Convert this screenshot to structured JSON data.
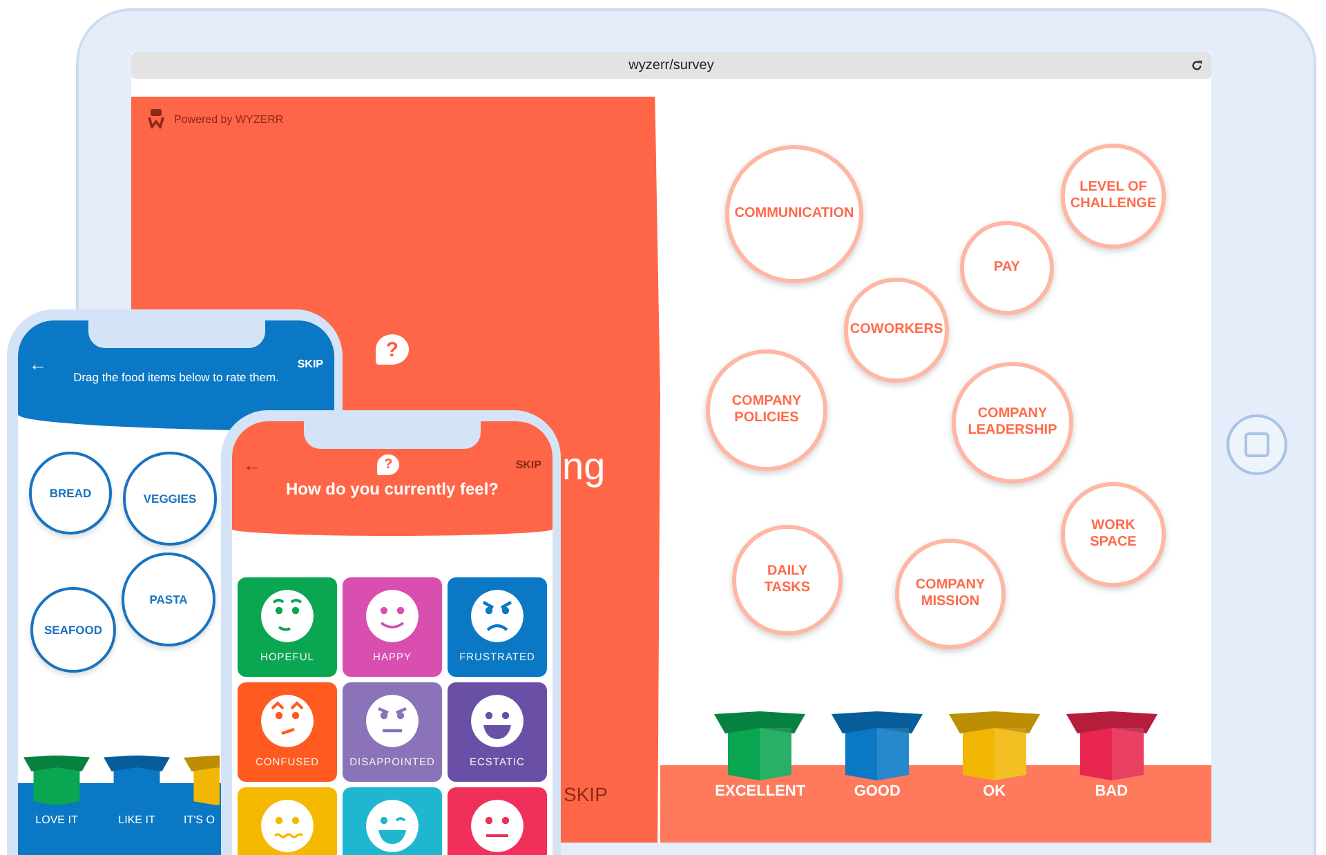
{
  "tablet": {
    "address": "wyzerr/survey",
    "powered_by": "Powered by WYZERR",
    "help_mark": "?",
    "question_fragment": "ng",
    "skip": "SKIP",
    "topics": [
      {
        "label": "COMMUNICATION"
      },
      {
        "label": "LEVEL OF CHALLENGE"
      },
      {
        "label": "PAY"
      },
      {
        "label": "COWORKERS"
      },
      {
        "label": "COMPANY POLICIES"
      },
      {
        "label": "COMPANY LEADERSHIP"
      },
      {
        "label": "WORK SPACE"
      },
      {
        "label": "DAILY TASKS"
      },
      {
        "label": "COMPANY MISSION"
      }
    ],
    "bins": [
      {
        "label": "EXCELLENT",
        "color": "#0aa651"
      },
      {
        "label": "GOOD",
        "color": "#0a78c4"
      },
      {
        "label": "OK",
        "color": "#f2b705"
      },
      {
        "label": "BAD",
        "color": "#e8264f"
      }
    ]
  },
  "food_phone": {
    "back": "←",
    "prompt": "Drag the food items below to rate them.",
    "skip": "SKIP",
    "items": [
      {
        "label": "BREAD"
      },
      {
        "label": "VEGGIES"
      },
      {
        "label": "PASTA"
      },
      {
        "label": "SEAFOOD"
      }
    ],
    "bins": [
      {
        "label": "LOVE IT",
        "color": "#0aa651"
      },
      {
        "label": "LIKE IT",
        "color": "#0a78c4"
      },
      {
        "label": "IT'S O",
        "color": "#f2b705"
      }
    ]
  },
  "mood_phone": {
    "back": "←",
    "help_mark": "?",
    "question": "How do you currently feel?",
    "skip": "SKIP",
    "moods": [
      {
        "label": "HOPEFUL",
        "color": "#0aa651",
        "kind": "hopeful"
      },
      {
        "label": "HAPPY",
        "color": "#d94fb0",
        "kind": "happy"
      },
      {
        "label": "FRUSTRATED",
        "color": "#0a78c4",
        "kind": "frustrated"
      },
      {
        "label": "CONFUSED",
        "color": "#ff5a1f",
        "kind": "confused"
      },
      {
        "label": "DISAPPOINTED",
        "color": "#8a73b8",
        "kind": "disappointed"
      },
      {
        "label": "ECSTATIC",
        "color": "#6a4fa6",
        "kind": "ecstatic"
      },
      {
        "color": "#f5b800",
        "kind": "uneasy"
      },
      {
        "color": "#1fb7d0",
        "kind": "wink"
      },
      {
        "color": "#f0305a",
        "kind": "neutral"
      }
    ]
  }
}
